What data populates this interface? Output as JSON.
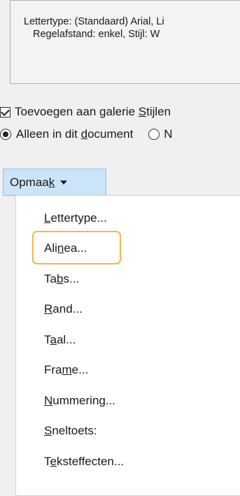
{
  "preview": {
    "line1": "Lettertype: (Standaard) Arial, Li",
    "line2": "Regelafstand:  enkel, Stijl: W"
  },
  "options": {
    "add_to_gallery": {
      "before": "Toevoegen aan galerie ",
      "underlined": "S",
      "after": "tijlen"
    },
    "only_this_doc": {
      "before": "Alleen in dit ",
      "underlined": "d",
      "after": "ocument"
    },
    "new_docs_label": "N"
  },
  "format_button": {
    "before": "Opmaa",
    "underlined": "k",
    "after": ""
  },
  "menu": {
    "items": [
      {
        "before": "",
        "underlined": "L",
        "after": "ettertype..."
      },
      {
        "before": "Ali",
        "underlined": "n",
        "after": "ea..."
      },
      {
        "before": "Ta",
        "underlined": "b",
        "after": "s..."
      },
      {
        "before": "",
        "underlined": "R",
        "after": "and..."
      },
      {
        "before": "T",
        "underlined": "a",
        "after": "al..."
      },
      {
        "before": "Fra",
        "underlined": "m",
        "after": "e..."
      },
      {
        "before": "",
        "underlined": "N",
        "after": "ummering..."
      },
      {
        "before": "",
        "underlined": "S",
        "after": "neltoets:"
      },
      {
        "before": "T",
        "underlined": "e",
        "after": "ksteffecten..."
      }
    ],
    "highlighted_index": 1
  },
  "colors": {
    "highlight_border": "#f3b64a",
    "button_bg": "#cce4f7",
    "accent_line": "#2b579a"
  }
}
